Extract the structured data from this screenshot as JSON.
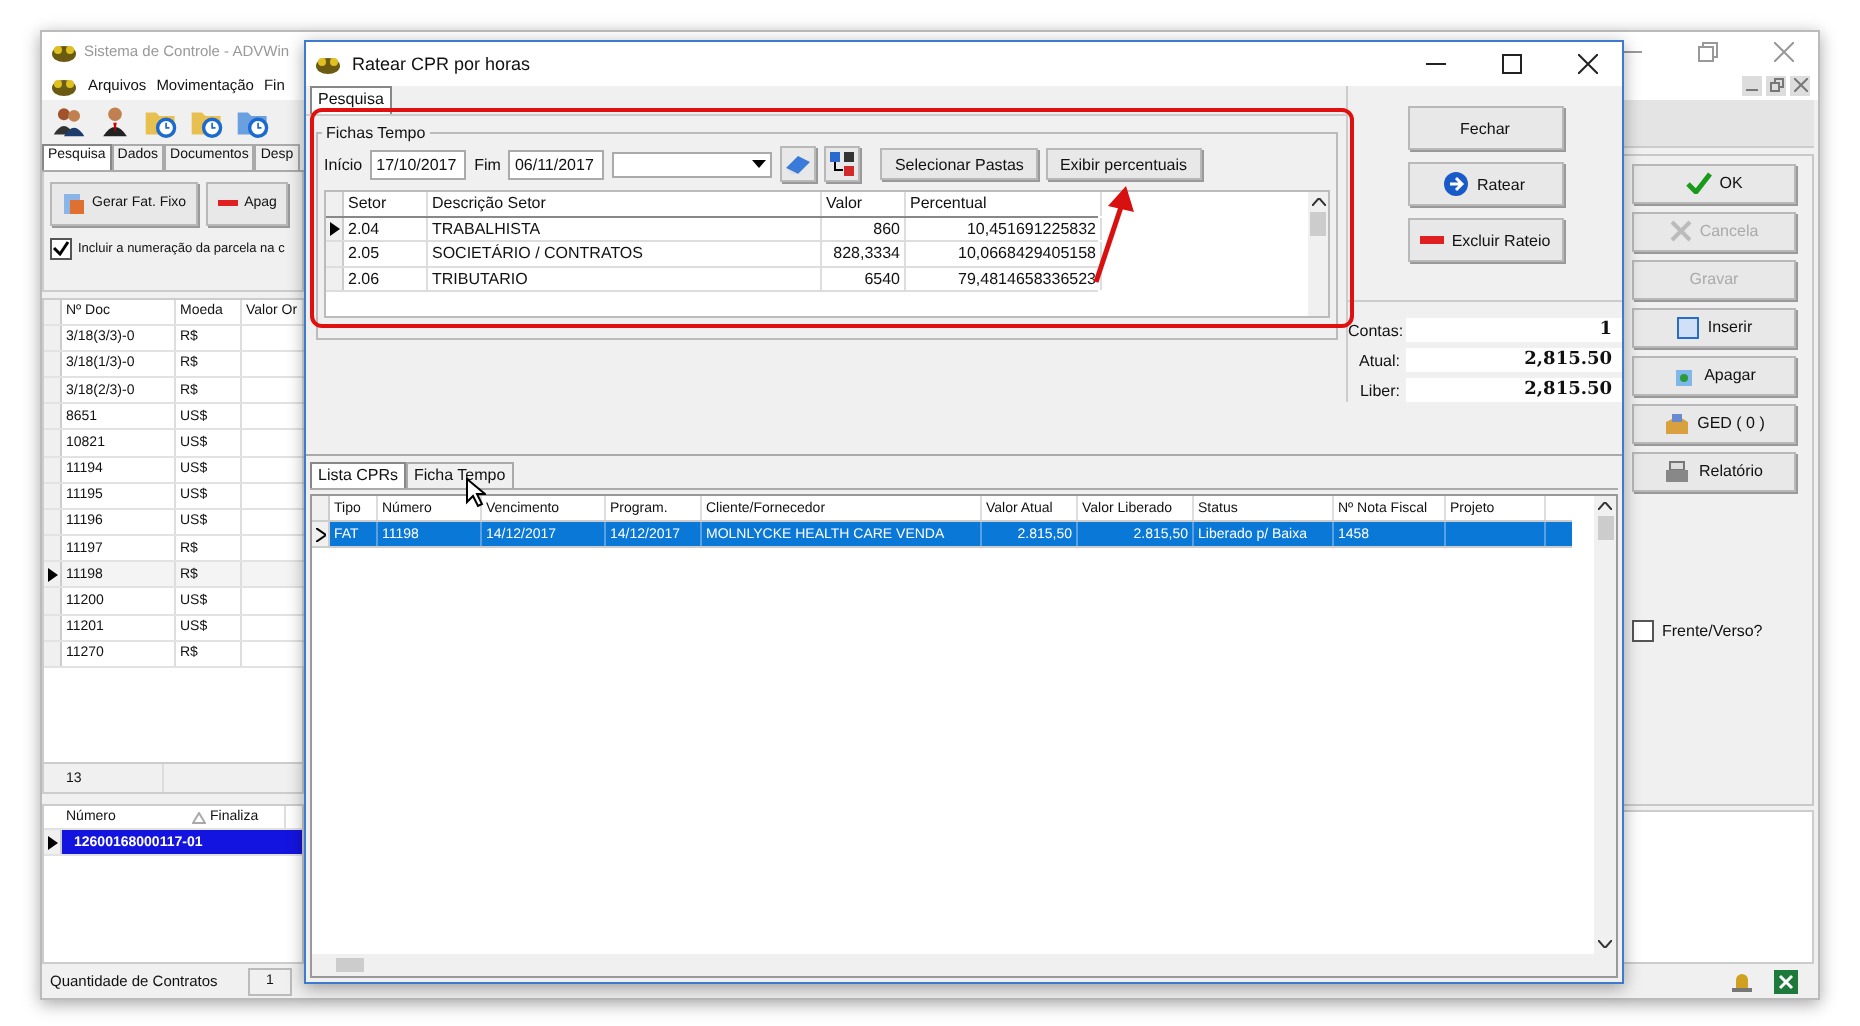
{
  "main_window": {
    "title": "Sistema de Controle - ADVWin",
    "menu": [
      "Arquivos",
      "Movimentação",
      "Fin"
    ],
    "tabs": [
      {
        "label": "Pesquisa",
        "selected": true
      },
      {
        "label": "Dados",
        "selected": false
      },
      {
        "label": "Documentos",
        "selected": false
      },
      {
        "label": "Desp",
        "selected": false
      }
    ],
    "action_buttons": [
      {
        "label": "Gerar Fat. Fixo",
        "kind": "invoice"
      },
      {
        "label": "Apag",
        "kind": "delete"
      }
    ],
    "include_installment": {
      "label": "Incluir a numeração da parcela na c",
      "checked": true
    },
    "doc_grid": {
      "columns": [
        "Nº Doc",
        "Moeda",
        "Valor Or"
      ],
      "rows": [
        {
          "doc": "3/18(3/3)-0",
          "currency": "R$",
          "selected": false
        },
        {
          "doc": "3/18(1/3)-0",
          "currency": "R$",
          "selected": false
        },
        {
          "doc": "3/18(2/3)-0",
          "currency": "R$",
          "selected": false
        },
        {
          "doc": "8651",
          "currency": "US$",
          "selected": false
        },
        {
          "doc": "10821",
          "currency": "US$",
          "selected": false
        },
        {
          "doc": "11194",
          "currency": "US$",
          "selected": false
        },
        {
          "doc": "11195",
          "currency": "US$",
          "selected": false
        },
        {
          "doc": "11196",
          "currency": "US$",
          "selected": false
        },
        {
          "doc": "11197",
          "currency": "R$",
          "selected": false
        },
        {
          "doc": "11198",
          "currency": "R$",
          "selected": true
        },
        {
          "doc": "11200",
          "currency": "US$",
          "selected": false
        },
        {
          "doc": "11201",
          "currency": "US$",
          "selected": false
        },
        {
          "doc": "11270",
          "currency": "R$",
          "selected": false
        }
      ],
      "footer": "13"
    },
    "contracts_grid": {
      "columns": [
        "Número",
        "Finaliza"
      ],
      "rows": [
        {
          "number": "12600168000117-01",
          "selected": true
        }
      ]
    },
    "status_label": "Quantidade de Contratos",
    "status_value": "1",
    "side_buttons": [
      {
        "label": "OK",
        "kind": "ok",
        "disabled": false
      },
      {
        "label": "Cancela",
        "kind": "cancel",
        "disabled": true
      },
      {
        "label": "Gravar",
        "kind": "none",
        "disabled": true
      },
      {
        "label": "Inserir",
        "kind": "insert",
        "disabled": false
      },
      {
        "label": "Apagar",
        "kind": "erase",
        "disabled": false
      },
      {
        "label": "GED ( 0 )",
        "kind": "ged",
        "disabled": false
      },
      {
        "label": "Relatório",
        "kind": "report",
        "disabled": false
      }
    ],
    "duplex": {
      "label": "Frente/Verso?",
      "checked": false
    }
  },
  "dialog": {
    "title": "Ratear CPR por horas",
    "tab": "Pesquisa",
    "group": "Fichas Tempo",
    "start_label": "Início",
    "start": "17/10/2017",
    "end_label": "Fim",
    "end": "06/11/2017",
    "buttons": [
      "Selecionar Pastas",
      "Exibir percentuais"
    ],
    "sector_grid": {
      "columns": [
        "Setor",
        "Descrição Setor",
        "Valor",
        "Percentual"
      ],
      "rows": [
        {
          "sector": "2.04",
          "description": "TRABALHISTA",
          "value": "860",
          "percent": "10,451691225832",
          "selected": true
        },
        {
          "sector": "2.05",
          "description": "SOCIETÁRIO / CONTRATOS",
          "value": "828,3334",
          "percent": "10,0668429405158",
          "selected": false
        },
        {
          "sector": "2.06",
          "description": "TRIBUTARIO",
          "value": "6540",
          "percent": "79,4814658336523",
          "selected": false
        }
      ]
    },
    "side_buttons": [
      {
        "label": "Fechar",
        "kind": "none"
      },
      {
        "label": "Ratear",
        "kind": "apportion"
      },
      {
        "label": "Excluir Rateio",
        "kind": "delete"
      }
    ],
    "totals": [
      {
        "label": "Contas:",
        "value": "1"
      },
      {
        "label": "Atual:",
        "value": "2,815.50"
      },
      {
        "label": "Liber:",
        "value": "2,815.50"
      }
    ],
    "tabs": [
      {
        "label": "Lista CPRs",
        "selected": true
      },
      {
        "label": "Ficha Tempo",
        "selected": false
      }
    ],
    "cpr_grid": {
      "columns": [
        "Tipo",
        "Número",
        "Vencimento",
        "Program.",
        "Cliente/Fornecedor",
        "Valor Atual",
        "Valor Liberado",
        "Status",
        "Nº Nota Fiscal",
        "Projeto"
      ],
      "rows": [
        {
          "cells": [
            "FAT",
            "11198",
            "14/12/2017",
            "14/12/2017",
            "MOLNLYCKE HEALTH CARE VENDA",
            "2.815,50",
            "2.815,50",
            "Liberado p/ Baixa",
            "1458",
            ""
          ],
          "selected": true
        }
      ]
    }
  }
}
